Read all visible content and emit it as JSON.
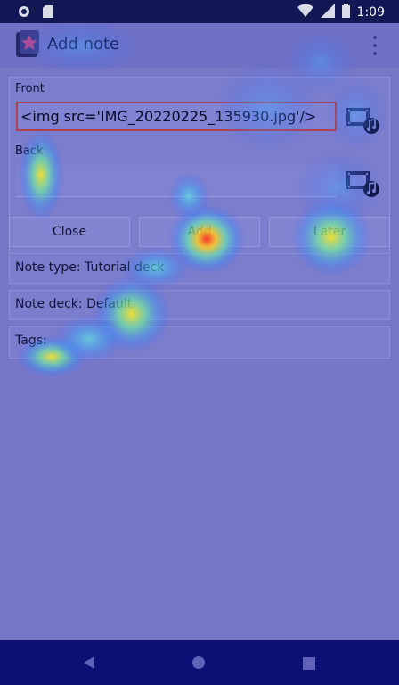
{
  "status_bar": {
    "time": "1:09"
  },
  "app_bar": {
    "title": "Add note",
    "app_icon": "star-deck-icon",
    "menu_icon": "overflow-menu-icon"
  },
  "fields": {
    "front": {
      "label": "Front",
      "value": "<img src='IMG_20220225_135930.jpg'/>"
    },
    "back": {
      "label": "Back",
      "value": ""
    }
  },
  "buttons": {
    "close": "Close",
    "add": "Add",
    "later": "Later"
  },
  "note_type": "Note type: Tutorial deck",
  "note_deck": "Note deck: Default",
  "tags": "Tags:",
  "colors": {
    "accent": "#2a2f9e",
    "front_border": "#b0404a",
    "status_bar": "#121854",
    "nav_bar": "#0b1074"
  }
}
